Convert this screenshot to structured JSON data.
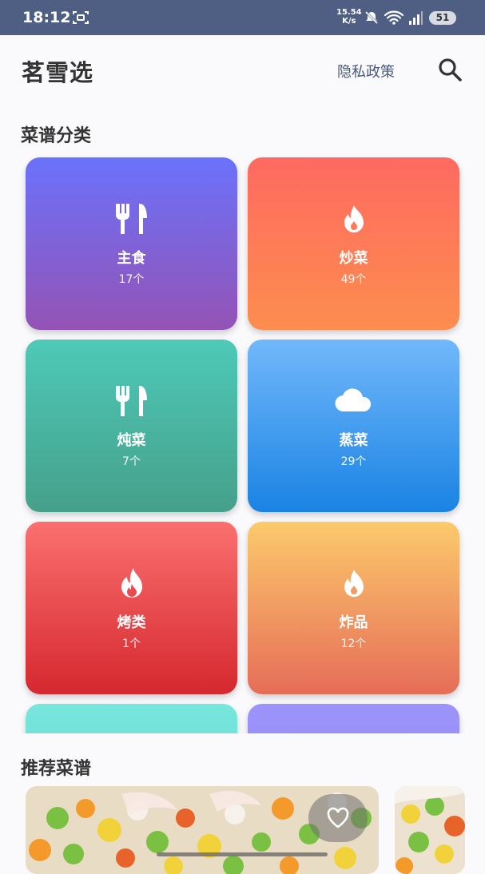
{
  "status_bar": {
    "time": "18:12",
    "net_speed_value": "15.54",
    "net_speed_unit": "K/s",
    "battery": "51",
    "icons": [
      "screen-record-icon",
      "mute-icon",
      "wifi-icon",
      "signal-icon",
      "battery-icon"
    ]
  },
  "header": {
    "title": "茗雪选",
    "privacy_label": "隐私政策",
    "search_icon": "search-icon"
  },
  "categories_section": {
    "title": "菜谱分类",
    "items": [
      {
        "name": "主食",
        "count": "17个",
        "icon": "fork-knife-icon",
        "colors": [
          "#6b72fb",
          "#9453b5"
        ]
      },
      {
        "name": "炒菜",
        "count": "49个",
        "icon": "fire-icon",
        "colors": [
          "#fe6a61",
          "#fd8d4e"
        ]
      },
      {
        "name": "炖菜",
        "count": "7个",
        "icon": "fork-knife-icon",
        "colors": [
          "#4ec9b8",
          "#45a08a"
        ]
      },
      {
        "name": "蒸菜",
        "count": "29个",
        "icon": "cloud-icon",
        "colors": [
          "#72b8fb",
          "#1a83e3"
        ]
      },
      {
        "name": "烤类",
        "count": "1个",
        "icon": "flame-icon",
        "colors": [
          "#fb706f",
          "#d5282f"
        ]
      },
      {
        "name": "炸品",
        "count": "12个",
        "icon": "fire-icon",
        "colors": [
          "#fcca6c",
          "#e66d58"
        ]
      },
      {
        "name": "",
        "count": "",
        "icon": "",
        "colors": [
          "#77e6dd",
          "#5fd0c6"
        ]
      },
      {
        "name": "",
        "count": "",
        "icon": "",
        "colors": [
          "#9d94fb",
          "#8a80f0"
        ]
      }
    ]
  },
  "recommend_section": {
    "title": "推荐菜谱",
    "favorite_icon": "heart-icon"
  }
}
